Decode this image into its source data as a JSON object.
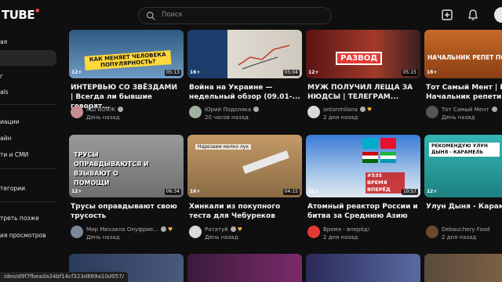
{
  "header": {
    "logo": "TUBE",
    "search_placeholder": "Поиск"
  },
  "sidebar": {
    "items": [
      {
        "label": "ая",
        "active": false
      },
      {
        "label": "",
        "active": true
      },
      {
        "label": "г",
        "active": false
      },
      {
        "label": "als",
        "active": false
      },
      {
        "label": "иации",
        "active": false
      },
      {
        "label": "айн",
        "active": false
      },
      {
        "label": "ти и СМИ",
        "active": false
      },
      {
        "label": "тегории",
        "active": false
      },
      {
        "label": "треть позже",
        "active": false
      },
      {
        "label": "ия просмотров",
        "active": false
      }
    ]
  },
  "videos": [
    {
      "title": "ИНТЕРВЬЮ СО ЗВЁЗДАМИ | Всегда ли бывшие говорят...",
      "channel": "АШ ВОЯЖ",
      "verified": true,
      "time": "День назад",
      "duration": "05:13",
      "age": "12+",
      "thumb_text": "КАК МЕНЯЕТ ЧЕЛОВЕКА ПОПУЛЯРНОСТЬ?",
      "thumb_color": "#3b6a8f"
    },
    {
      "title": "Война на Украине — недельный обзор (09.01-...",
      "channel": "Юрий Подоляка",
      "verified": true,
      "time": "20 часов назад",
      "duration": "05:04",
      "age": "16+",
      "thumb_text": "",
      "thumb_color": "#d9d4cc"
    },
    {
      "title": "МУЖ ПОЛУЧИЛ ЛЕЩА ЗА НЮДСЫ | ТЕЛЕГРАМ...",
      "channel": "antonmilana",
      "verified": true,
      "time": "2 дня назад",
      "duration": "05:15",
      "age": "12+",
      "thumb_text": "РАЗВОД",
      "thumb_color": "#7a1f1f"
    },
    {
      "title": "Тот Самый Мент | Бывший Начальник репетиции...",
      "channel": "Тот Самый Мент",
      "verified": true,
      "time": "День назад",
      "duration": "",
      "age": "18+",
      "thumb_text": "НАЧАЛЬНИК РЕПЕТ ПОХМЕЛ",
      "thumb_color": "#b8541e"
    },
    {
      "title": "Трусы оправдывают свою трусость",
      "channel": "Мир Михаила Онуфрие...",
      "verified": true,
      "time": "День назад",
      "duration": "06:34",
      "age": "12+",
      "thumb_text": "ТРУСЫ ОПРАВДЫВАЮТСЯ И ВЗЫВАЮТ О ПОМОЩИ",
      "thumb_color": "#8e8e8e"
    },
    {
      "title": "Хинкали из покупного теста для Чебуреков",
      "channel": "Рататуй",
      "verified": true,
      "time": "День назад",
      "duration": "04:15",
      "age": "16+",
      "thumb_text": "Нарезаем мелко лук",
      "thumb_color": "#b58a5a"
    },
    {
      "title": "Атомный реактор России и битва за Среднюю Азию",
      "channel": "Время - вперёд!",
      "verified": false,
      "time": "2 дня назад",
      "duration": "10:57",
      "age": "12+",
      "thumb_text": "#535 ВРЕМЯ ВПЕРЁД",
      "thumb_color": "#2f6fb0"
    },
    {
      "title": "Улун Дыня - Карамель",
      "channel": "Debauchery Food",
      "verified": false,
      "time": "2 дня назад",
      "duration": "",
      "age": "12+",
      "thumb_text": "РЕКОМЕНДУЮ УЛУН ДЫНЯ - КАРАМЕЛЬ",
      "thumb_color": "#2aa7a6"
    }
  ],
  "status_bar": {
    "url": "ideo/d9f7fbeada34bf14cf323d669a10d057/"
  },
  "colors": {
    "background": "#0f0f0f",
    "accent": "#ff0000",
    "text_secondary": "#aaaaaa"
  }
}
